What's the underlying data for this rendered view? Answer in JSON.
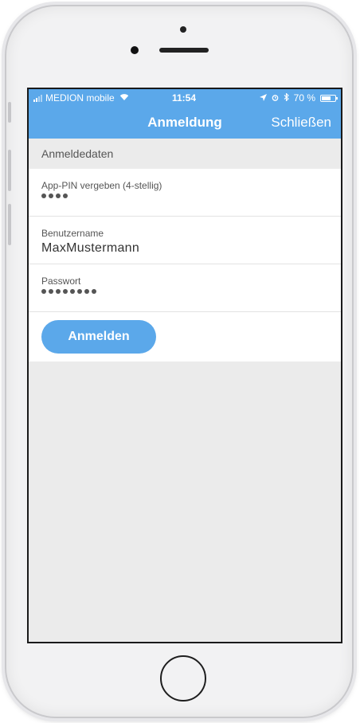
{
  "status_bar": {
    "carrier": "MEDION mobile",
    "time": "11:54",
    "battery": "70 %",
    "battery_level": 0.7,
    "icons": [
      "signal-icon",
      "wifi-icon",
      "location-icon",
      "alarm-icon",
      "bluetooth-icon",
      "battery-icon"
    ]
  },
  "nav": {
    "title": "Anmeldung",
    "close_label": "Schließen"
  },
  "section": {
    "title": "Anmeldedaten"
  },
  "form": {
    "pin": {
      "label": "App-PIN vergeben (4-stellig)",
      "masked_length": 4
    },
    "username": {
      "label": "Benutzername",
      "value": "MaxMustermann"
    },
    "password": {
      "label": "Passwort",
      "masked_length": 8
    }
  },
  "login_button": {
    "label": "Anmelden"
  },
  "colors": {
    "accent": "#5ba8ea",
    "background": "#ebebeb"
  }
}
